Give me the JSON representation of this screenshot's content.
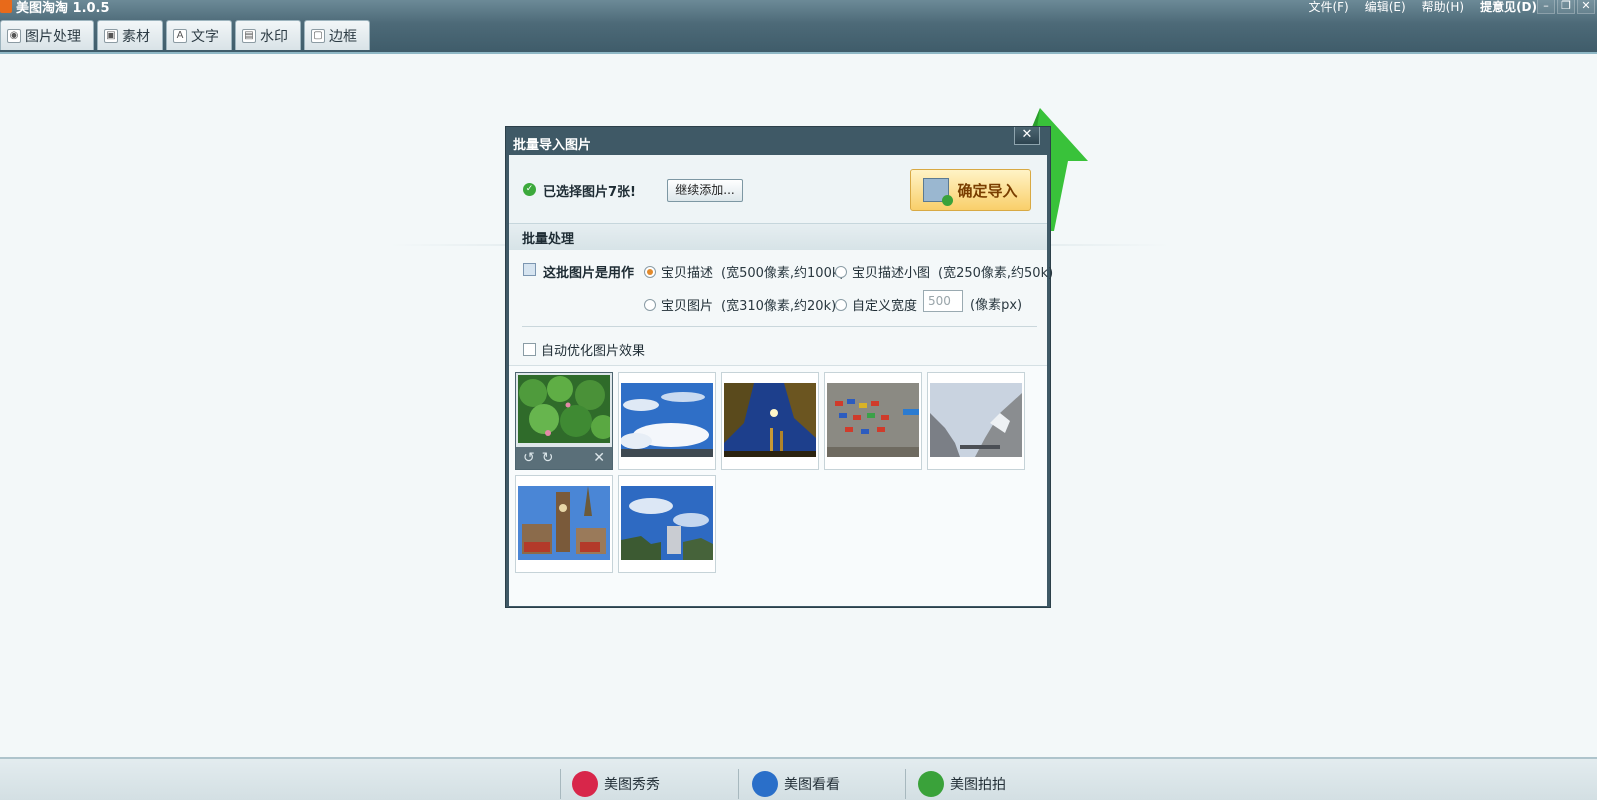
{
  "app": {
    "title": "美图淘淘 1.0.5"
  },
  "menu": {
    "file": "文件(F)",
    "edit": "编辑(E)",
    "help": "帮助(H)",
    "feedback": "提意见(D)"
  },
  "tabs": [
    {
      "label": "图片处理",
      "icon": "image-process-icon"
    },
    {
      "label": "素材",
      "icon": "material-icon"
    },
    {
      "label": "文字",
      "icon": "text-icon"
    },
    {
      "label": "水印",
      "icon": "watermark-icon"
    },
    {
      "label": "边框",
      "icon": "frame-icon"
    }
  ],
  "dialog": {
    "title": "批量导入图片",
    "selected_text": "已选择图片7张!",
    "add_more": "继续添加...",
    "confirm": "确定导入",
    "batch_header": "批量处理",
    "use_label": "这批图片是用作",
    "options": [
      {
        "label": "宝贝描述",
        "hint": "(宽500像素,约100k)",
        "selected": true
      },
      {
        "label": "宝贝描述小图",
        "hint": "(宽250像素,约50k)",
        "selected": false
      },
      {
        "label": "宝贝图片",
        "hint": "(宽310像素,约20k)",
        "selected": false
      },
      {
        "label": "自定义宽度",
        "hint": "",
        "selected": false
      }
    ],
    "custom_width_value": "500",
    "custom_width_unit": "(像素px)",
    "optimize_label": "自动优化图片效果",
    "optimize_checked": false,
    "thumbnail_count": 7
  },
  "bottom": {
    "items": [
      "美图秀秀",
      "美图看看",
      "美图拍拍"
    ]
  },
  "colors": {
    "titlebar": "#4d6a78",
    "confirm_button": "#f9cf6a",
    "accent_green": "#3aa23a"
  }
}
